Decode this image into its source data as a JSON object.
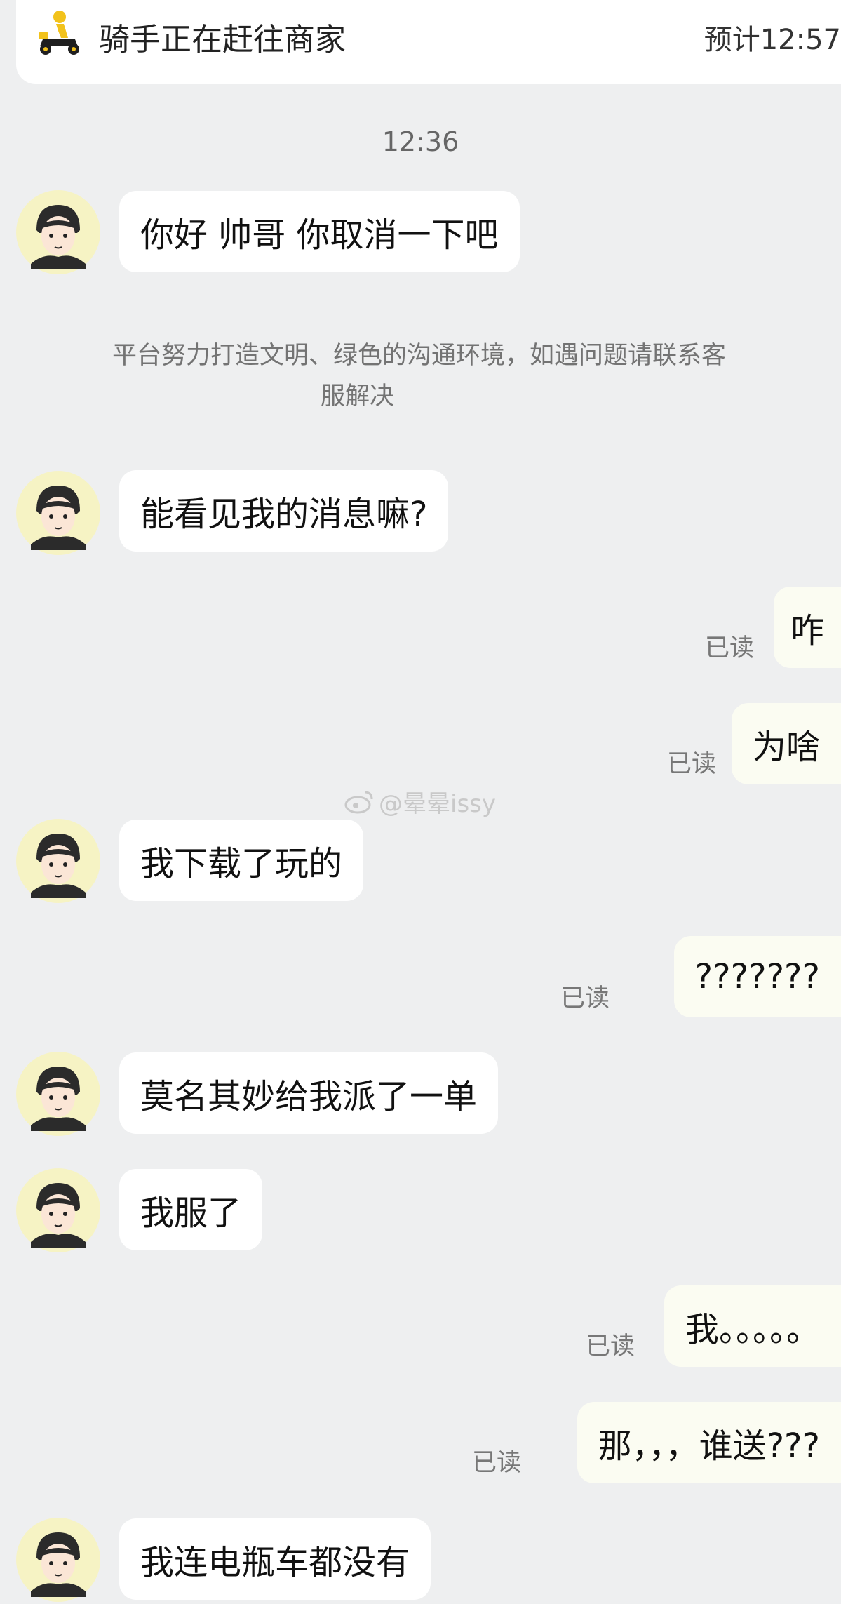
{
  "header": {
    "status": "骑手正在赶往商家",
    "eta": "预计12:57",
    "icon": "rider-scooter-icon"
  },
  "chat": {
    "timestamp": "12:36",
    "notice_line1": "平台努力打造文明、绿色的沟通环境，如遇问题请联系客",
    "notice_line2": "服解决",
    "read_label": "已读",
    "messages": [
      {
        "side": "left",
        "text": "你好 帅哥 你取消一下吧"
      },
      {
        "side": "left",
        "text": "能看见我的消息嘛?"
      },
      {
        "side": "right",
        "text": "咋"
      },
      {
        "side": "right",
        "text": "为啥"
      },
      {
        "side": "left",
        "text": "我下载了玩的"
      },
      {
        "side": "right",
        "text": "???????"
      },
      {
        "side": "left",
        "text": "莫名其妙给我派了一单"
      },
      {
        "side": "left",
        "text": "我服了"
      },
      {
        "side": "right",
        "text": "我。。。。。"
      },
      {
        "side": "right",
        "text": "那，，，谁送???"
      },
      {
        "side": "left",
        "text": "我连电瓶车都没有"
      }
    ]
  },
  "watermark": "@晕晕issy",
  "colors": {
    "background": "#eeeff0",
    "bubble_left": "#ffffff",
    "bubble_right": "#fbfcf2",
    "avatar_ring": "#f6f3c4",
    "brand_yellow": "#f2c21b"
  }
}
